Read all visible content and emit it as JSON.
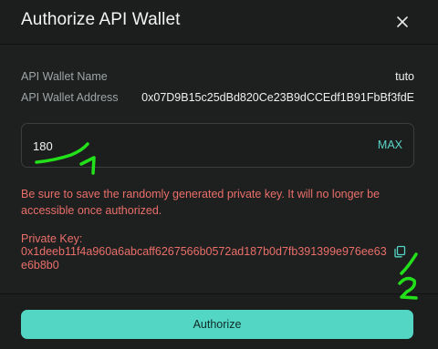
{
  "modal": {
    "title": "Authorize API Wallet"
  },
  "fields": {
    "name_label": "API Wallet Name",
    "name_value": "tuto",
    "address_label": "API Wallet Address",
    "address_value": "0x07D9B15c25dBd820Ce23B9dCCEdf1B91FbBf3fdE"
  },
  "days_input": {
    "value": "180",
    "max_label": "MAX"
  },
  "warning": "Be sure to save the randomly generated private key. It will no longer be accessible once authorized.",
  "private_key": {
    "label": "Private Key:",
    "value": "0x1deeb11f4a960a6abcaff6267566b0572ad187b0d7fb391399e976ee63e6b8b0"
  },
  "authorize_button": "Authorize",
  "annotations": {
    "step_1": "1",
    "step_2": "2"
  },
  "colors": {
    "accent": "#54d6c4",
    "error": "#ea6f6a",
    "annotation": "#22e11a"
  }
}
